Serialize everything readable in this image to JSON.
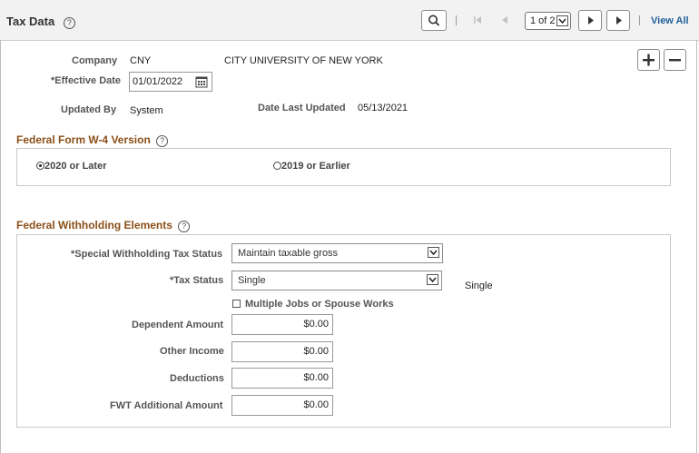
{
  "header": {
    "title": "Tax Data",
    "pager": "1 of 2",
    "view_all": "View All"
  },
  "company": {
    "label": "Company",
    "code": "CNY",
    "name": "CITY UNIVERSITY OF NEW YORK"
  },
  "effective_date": {
    "label": "*Effective Date",
    "value": "01/01/2022"
  },
  "updated_by": {
    "label": "Updated By",
    "value": "System"
  },
  "date_last_updated": {
    "label": "Date Last Updated",
    "value": "05/13/2021"
  },
  "w4_section": {
    "title": "Federal Form W-4 Version",
    "options": [
      {
        "label": "2020 or Later",
        "selected": true
      },
      {
        "label": "2019 or Earlier",
        "selected": false
      }
    ]
  },
  "fwh_section": {
    "title": "Federal Withholding Elements",
    "special_status": {
      "label": "*Special Withholding Tax Status",
      "value": "Maintain taxable gross"
    },
    "tax_status": {
      "label": "*Tax Status",
      "value": "Single",
      "display": "Single"
    },
    "multiple_jobs": {
      "label": "Multiple Jobs or Spouse Works",
      "checked": false
    },
    "dependent_amount": {
      "label": "Dependent Amount",
      "value": "$0.00"
    },
    "other_income": {
      "label": "Other Income",
      "value": "$0.00"
    },
    "deductions": {
      "label": "Deductions",
      "value": "$0.00"
    },
    "fwt_additional": {
      "label": "FWT Additional Amount",
      "value": "$0.00"
    }
  },
  "icons": {
    "help": "?"
  }
}
